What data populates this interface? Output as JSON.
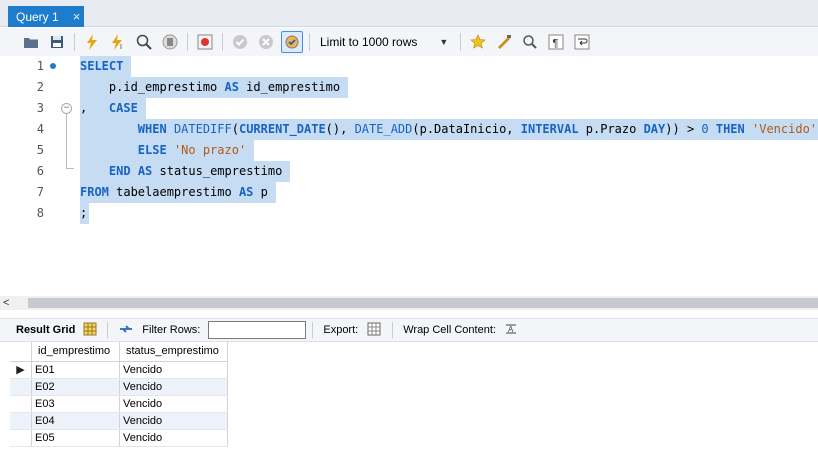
{
  "tab": {
    "title": "Query 1",
    "close": "×"
  },
  "toolbar": {
    "limit_label": "Limit to 1000 rows",
    "dropdown": "▼"
  },
  "editor": {
    "lines": [
      {
        "n": "1"
      },
      {
        "n": "2"
      },
      {
        "n": "3"
      },
      {
        "n": "4"
      },
      {
        "n": "5"
      },
      {
        "n": "6"
      },
      {
        "n": "7"
      },
      {
        "n": "8"
      }
    ],
    "tokens": {
      "select": "SELECT",
      "l2_pre": "    p.id_emprestimo ",
      "as": "AS",
      "l2_post": " id_emprestimo",
      "l3_comma": ",   ",
      "case": "CASE",
      "when": "WHEN",
      "datediff": "DATEDIFF",
      "current_date": "CURRENT_DATE",
      "date_add": "DATE_ADD",
      "l4_mid": "(p.DataInicio, ",
      "interval": "INTERVAL",
      "l4_prazo": " p.Prazo ",
      "day": "DAY",
      "gt": ")) > ",
      "zero": "0",
      "then": "THEN",
      "vencido": "'Vencido'",
      "else": "ELSE",
      "no_prazo": "'No prazo'",
      "end": "END",
      "status": " status_emprestimo",
      "from": "FROM",
      "table": " tabelaemprestimo ",
      "alias": " p",
      "semicolon": ";"
    }
  },
  "scroll": {
    "left_arrow": "<"
  },
  "result_toolbar": {
    "result_grid": "Result Grid",
    "filter_rows": "Filter Rows:",
    "export": "Export:",
    "wrap_cell": "Wrap Cell Content:"
  },
  "grid": {
    "columns": [
      "id_emprestimo",
      "status_emprestimo"
    ],
    "rows": [
      [
        "E01",
        "Vencido"
      ],
      [
        "E02",
        "Vencido"
      ],
      [
        "E03",
        "Vencido"
      ],
      [
        "E04",
        "Vencido"
      ],
      [
        "E05",
        "Vencido"
      ]
    ],
    "pointer": "▶"
  }
}
